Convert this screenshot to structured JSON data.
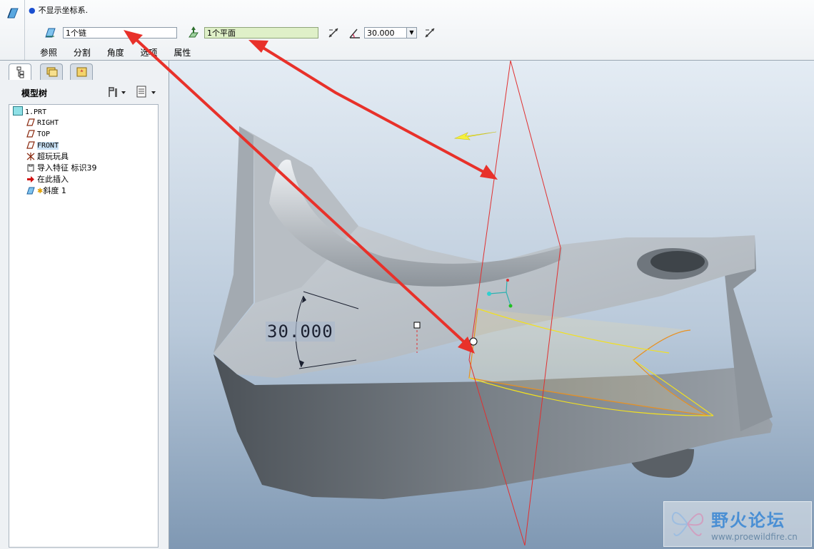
{
  "dashboard": {
    "message": "不显示坐标系.",
    "chain_value": "1个链",
    "plane_value": "1个平面",
    "angle_value": "30.000",
    "tabs": [
      "参照",
      "分割",
      "角度",
      "选项",
      "属性"
    ]
  },
  "model_tree": {
    "title": "模型树",
    "items": [
      {
        "label": "1.PRT",
        "icon": "part-icon"
      },
      {
        "label": "RIGHT",
        "icon": "datum-plane-icon"
      },
      {
        "label": "TOP",
        "icon": "datum-plane-icon"
      },
      {
        "label": "FRONT",
        "icon": "datum-plane-icon"
      },
      {
        "label": "超玩玩具",
        "icon": "csys-icon"
      },
      {
        "label": "导入特征 标识39",
        "icon": "import-feature-icon"
      },
      {
        "label": "在此插入",
        "icon": "insert-here-arrow-icon"
      },
      {
        "label": "斜度 1",
        "icon": "draft-feature-icon"
      }
    ]
  },
  "viewport": {
    "dimension_label": "30.000"
  },
  "watermark": {
    "title": "野火论坛",
    "url": "www.proewildfire.cn"
  },
  "colors": {
    "annotation_arrow": "#e8312a",
    "datum_plane": "#e03030",
    "selection_curve": "#f2e020",
    "edge_orange": "#e89020"
  }
}
